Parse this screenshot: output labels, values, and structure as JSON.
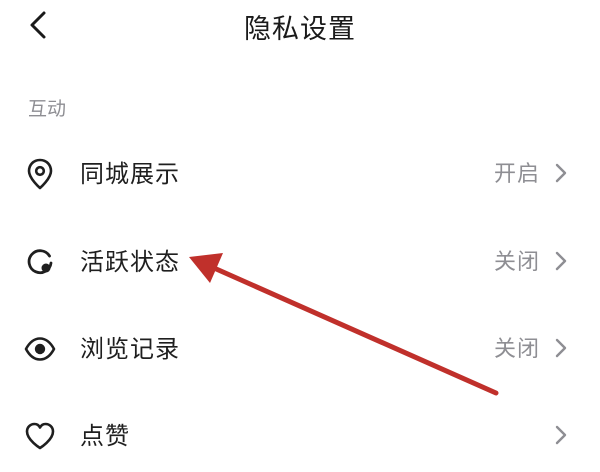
{
  "header": {
    "title": "隐私设置",
    "back_icon": "chevron-left-icon"
  },
  "section": {
    "label": "互动"
  },
  "settings": [
    {
      "label": "同城展示",
      "value": "开启",
      "icon": "location-pin-icon"
    },
    {
      "label": "活跃状态",
      "value": "关闭",
      "icon": "activity-status-icon"
    },
    {
      "label": "浏览记录",
      "value": "关闭",
      "icon": "eye-icon"
    },
    {
      "label": "点赞",
      "value": "",
      "icon": "heart-icon"
    }
  ],
  "annotation": {
    "color": "#c0302b",
    "target": "活跃状态"
  },
  "colors": {
    "text_primary": "#1f1f1f",
    "text_secondary": "#8e8e93",
    "background": "#ffffff"
  }
}
